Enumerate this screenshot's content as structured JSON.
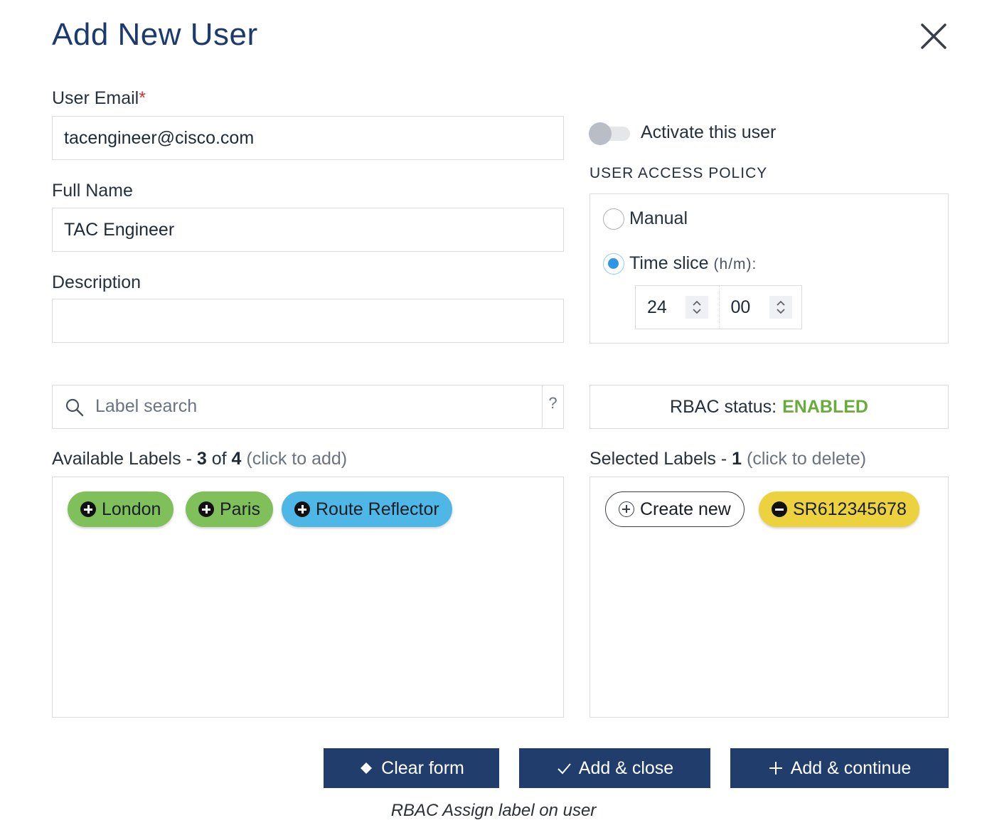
{
  "dialog": {
    "title": "Add New User"
  },
  "form": {
    "email": {
      "label": "User Email",
      "required_mark": "*",
      "value": "tacengineer@cisco.com"
    },
    "full_name": {
      "label": "Full Name",
      "value": "TAC Engineer"
    },
    "description": {
      "label": "Description",
      "value": ""
    }
  },
  "activate": {
    "label": "Activate this user",
    "enabled": false
  },
  "access_policy": {
    "heading": "USER ACCESS POLICY",
    "options": [
      {
        "label": "Manual",
        "selected": false
      },
      {
        "label": "Time slice",
        "suffix": "(h/m):",
        "selected": true
      }
    ],
    "hours": "24",
    "minutes": "00"
  },
  "search": {
    "placeholder": "Label search",
    "help": "?"
  },
  "rbac": {
    "label": "RBAC status:",
    "value": "ENABLED",
    "value_color": "#6aab3c"
  },
  "available": {
    "title": "Available Labels",
    "sep": "-",
    "shown": "3",
    "of": "of",
    "total": "4",
    "hint": "(click to add)",
    "labels": [
      {
        "text": "London",
        "color": "#7fc05a"
      },
      {
        "text": "Paris",
        "color": "#7fc05a"
      },
      {
        "text": "Route Reflector",
        "color": "#4fb7e6"
      }
    ]
  },
  "selected": {
    "title": "Selected Labels",
    "sep": "-",
    "count": "1",
    "hint": "(click to delete)",
    "create_label": "Create new",
    "labels": [
      {
        "text": "SR612345678",
        "color": "#ebd23e"
      }
    ]
  },
  "buttons": {
    "clear": "Clear form",
    "add_close": "Add & close",
    "add_continue": "Add & continue",
    "color": "#213d6b"
  },
  "caption": "RBAC Assign label on user"
}
